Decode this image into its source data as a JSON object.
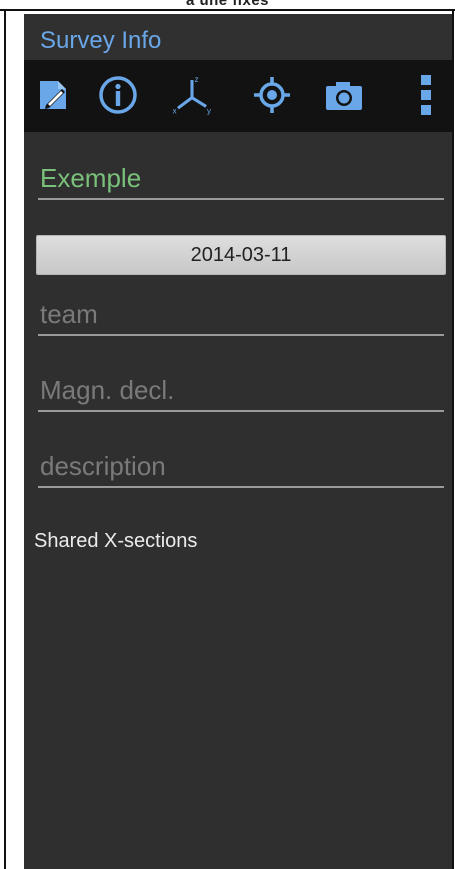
{
  "caption": "a une fixes",
  "title_bar": {
    "title": "Survey Info"
  },
  "toolbar": {
    "buttons": [
      {
        "icon": "note-edit-icon",
        "label": "Note"
      },
      {
        "icon": "info-icon",
        "label": "Info"
      },
      {
        "icon": "3d-axes-icon",
        "label": "3D"
      },
      {
        "icon": "gps-locate-icon",
        "label": "Locate"
      },
      {
        "icon": "camera-icon",
        "label": "Photo"
      },
      {
        "icon": "overflow-menu-icon",
        "label": "Menu"
      }
    ],
    "icon_color": "#6aa7e8"
  },
  "form": {
    "name_value": "Exemple",
    "date_value": "2014-03-11",
    "team_placeholder": "team",
    "decl_placeholder": "Magn. decl.",
    "description_placeholder": "description",
    "shared_label": "Shared X-sections"
  },
  "colors": {
    "background": "#2f2f2f",
    "toolbar": "#121212",
    "accent_blue": "#6aa7e8",
    "name_green": "#79c17a",
    "placeholder_grey": "#7a7a7a"
  }
}
